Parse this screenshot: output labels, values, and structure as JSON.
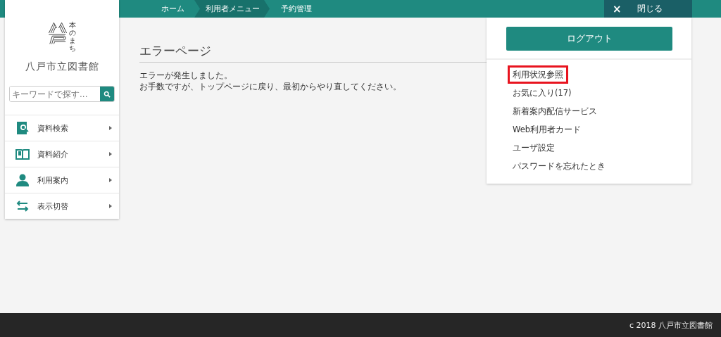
{
  "breadcrumb": [
    {
      "label": "ホーム",
      "selected": false
    },
    {
      "label": "利用者メニュー",
      "selected": true
    },
    {
      "label": "予約管理",
      "selected": false
    }
  ],
  "close_button": {
    "icon": "×",
    "label": "閉じる"
  },
  "sidebar": {
    "logo_text": "本のまち",
    "library_name": "八戸市立図書館",
    "search": {
      "placeholder": "キーワードで探す..."
    },
    "items": [
      {
        "label": "資料検索"
      },
      {
        "label": "資料紹介"
      },
      {
        "label": "利用案内"
      },
      {
        "label": "表示切替"
      }
    ]
  },
  "main": {
    "title": "エラーページ",
    "lines": [
      "エラーが発生しました。",
      "お手数ですが、トップページに戻り、最初からやり直してください。"
    ]
  },
  "user_menu": {
    "logout_button": "ログアウト",
    "items": [
      {
        "label": "利用状況参照",
        "highlighted": true
      },
      {
        "label": "お気に入り(17)",
        "highlighted": false
      },
      {
        "label": "新着案内配信サービス",
        "highlighted": false
      },
      {
        "label": "Web利用者カード",
        "highlighted": false
      },
      {
        "label": "ユーザ設定",
        "highlighted": false
      },
      {
        "label": "パスワードを忘れたとき",
        "highlighted": false
      }
    ]
  },
  "footer": {
    "copyright": "c 2018 八戸市立図書館"
  }
}
